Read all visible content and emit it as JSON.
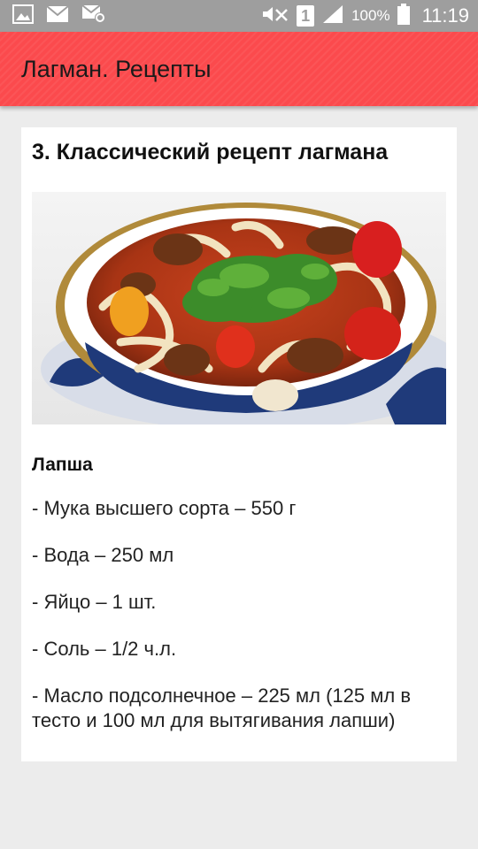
{
  "status_bar": {
    "left_icons": [
      "image-icon",
      "mail-icon",
      "mail-settings-icon"
    ],
    "right_icons": [
      "mute-icon",
      "sim-icon",
      "signal-icon"
    ],
    "sim_number": "1",
    "battery_percent": "100%",
    "time": "11:19"
  },
  "app_bar": {
    "title": "Лагман. Рецепты",
    "color": "#fb4a4d"
  },
  "recipe": {
    "title": "3. Классический рецепт лагмана",
    "section": "Лапша",
    "ingredients": [
      "- Мука высшего сорта – 550 г",
      "- Вода – 250 мл",
      "- Яйцо – 1 шт.",
      "- Соль – 1/2 ч.л.",
      "- Масло подсолнечное – 225 мл (125 мл в тесто и 100 мл для вытягивания лапши)"
    ]
  }
}
